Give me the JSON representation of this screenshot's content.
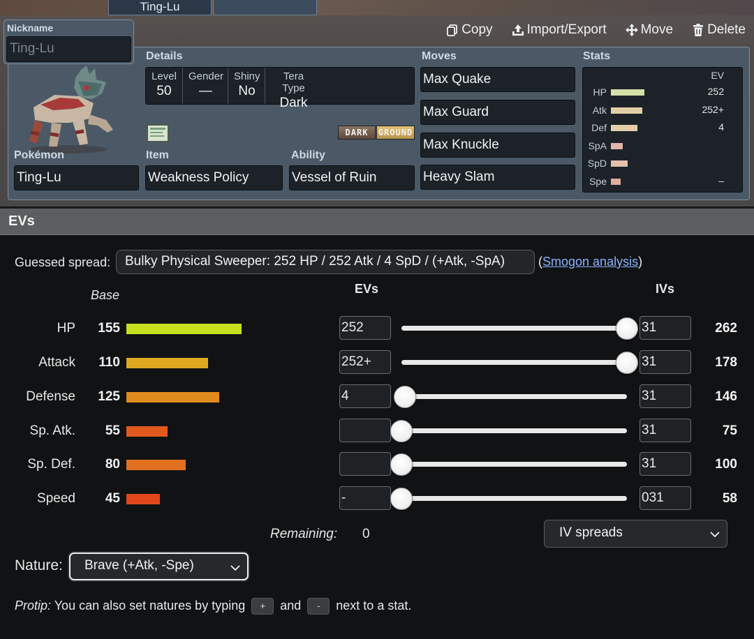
{
  "tabs": [
    {
      "label": "Ting-Lu"
    },
    {
      "label": ""
    }
  ],
  "nickname": {
    "label": "Nickname",
    "placeholder": "Ting-Lu"
  },
  "actions": {
    "copy": "Copy",
    "import_export": "Import/Export",
    "move": "Move",
    "delete": "Delete"
  },
  "details": {
    "heading": "Details",
    "level_label": "Level",
    "level": "50",
    "gender_label": "Gender",
    "gender": "—",
    "shiny_label": "Shiny",
    "shiny": "No",
    "tera_label": "Tera Type",
    "tera": "Dark"
  },
  "types": [
    "DARK",
    "GROUND"
  ],
  "pokemon": {
    "label": "Pokémon",
    "value": "Ting-Lu"
  },
  "item": {
    "label": "Item",
    "value": "Weakness Policy",
    "icon": "scroll-icon"
  },
  "ability": {
    "label": "Ability",
    "value": "Vessel of Ruin"
  },
  "moves": {
    "heading": "Moves",
    "list": [
      "Max Quake",
      "Max Guard",
      "Max Knuckle",
      "Heavy Slam"
    ]
  },
  "stats_panel": {
    "heading": "Stats",
    "ev_header": "EV",
    "rows": [
      {
        "label": "HP",
        "ev": "252",
        "bar": 0.85
      },
      {
        "label": "Atk",
        "ev": "252+",
        "bar": 0.8
      },
      {
        "label": "Def",
        "ev": "4",
        "bar": 0.68
      },
      {
        "label": "SpA",
        "ev": "",
        "bar": 0.3
      },
      {
        "label": "SpD",
        "ev": "",
        "bar": 0.43
      },
      {
        "label": "Spe",
        "ev": "–",
        "bar": 0.25
      }
    ]
  },
  "evs": {
    "header": "EVs",
    "guessed_label": "Guessed spread:",
    "guessed_value": "Bulky Physical Sweeper: 252 HP / 252 Atk / 4 SpD / (+Atk, -SpA)",
    "smogon_prefix": "(",
    "smogon_link": "Smogon analysis",
    "smogon_suffix": ")",
    "base_header": "Base",
    "evs_header": "EVs",
    "ivs_header": "IVs",
    "rows": [
      {
        "stat": "HP",
        "base": "155",
        "base_color": "#c6e01e",
        "ev": "252",
        "ev_level": 1.0,
        "iv": "31",
        "total": "262"
      },
      {
        "stat": "Attack",
        "base": "110",
        "base_color": "#e0a820",
        "ev": "252+",
        "ev_level": 1.0,
        "iv": "31",
        "total": "178"
      },
      {
        "stat": "Defense",
        "base": "125",
        "base_color": "#e08a1c",
        "ev": "4",
        "ev_level": 0.016,
        "iv": "31",
        "total": "146"
      },
      {
        "stat": "Sp. Atk.",
        "base": "55",
        "base_color": "#e05a1e",
        "ev": "",
        "ev_level": 0,
        "iv": "31",
        "total": "75"
      },
      {
        "stat": "Sp. Def.",
        "base": "80",
        "base_color": "#e07020",
        "ev": "",
        "ev_level": 0,
        "iv": "31",
        "total": "100"
      },
      {
        "stat": "Speed",
        "base": "45",
        "base_color": "#e0481c",
        "ev": "-",
        "ev_level": 0,
        "iv": "031",
        "total": "58"
      }
    ],
    "remaining_label": "Remaining:",
    "remaining_value": "0",
    "iv_spreads": "IV spreads",
    "nature_label": "Nature:",
    "nature_value": "Brave (+Atk, -Spe)",
    "protip_label": "Protip:",
    "protip_text_1": " You can also set natures by typing ",
    "protip_key_plus": "+",
    "protip_text_2": " and ",
    "protip_key_minus": "-",
    "protip_text_3": " next to a stat."
  }
}
